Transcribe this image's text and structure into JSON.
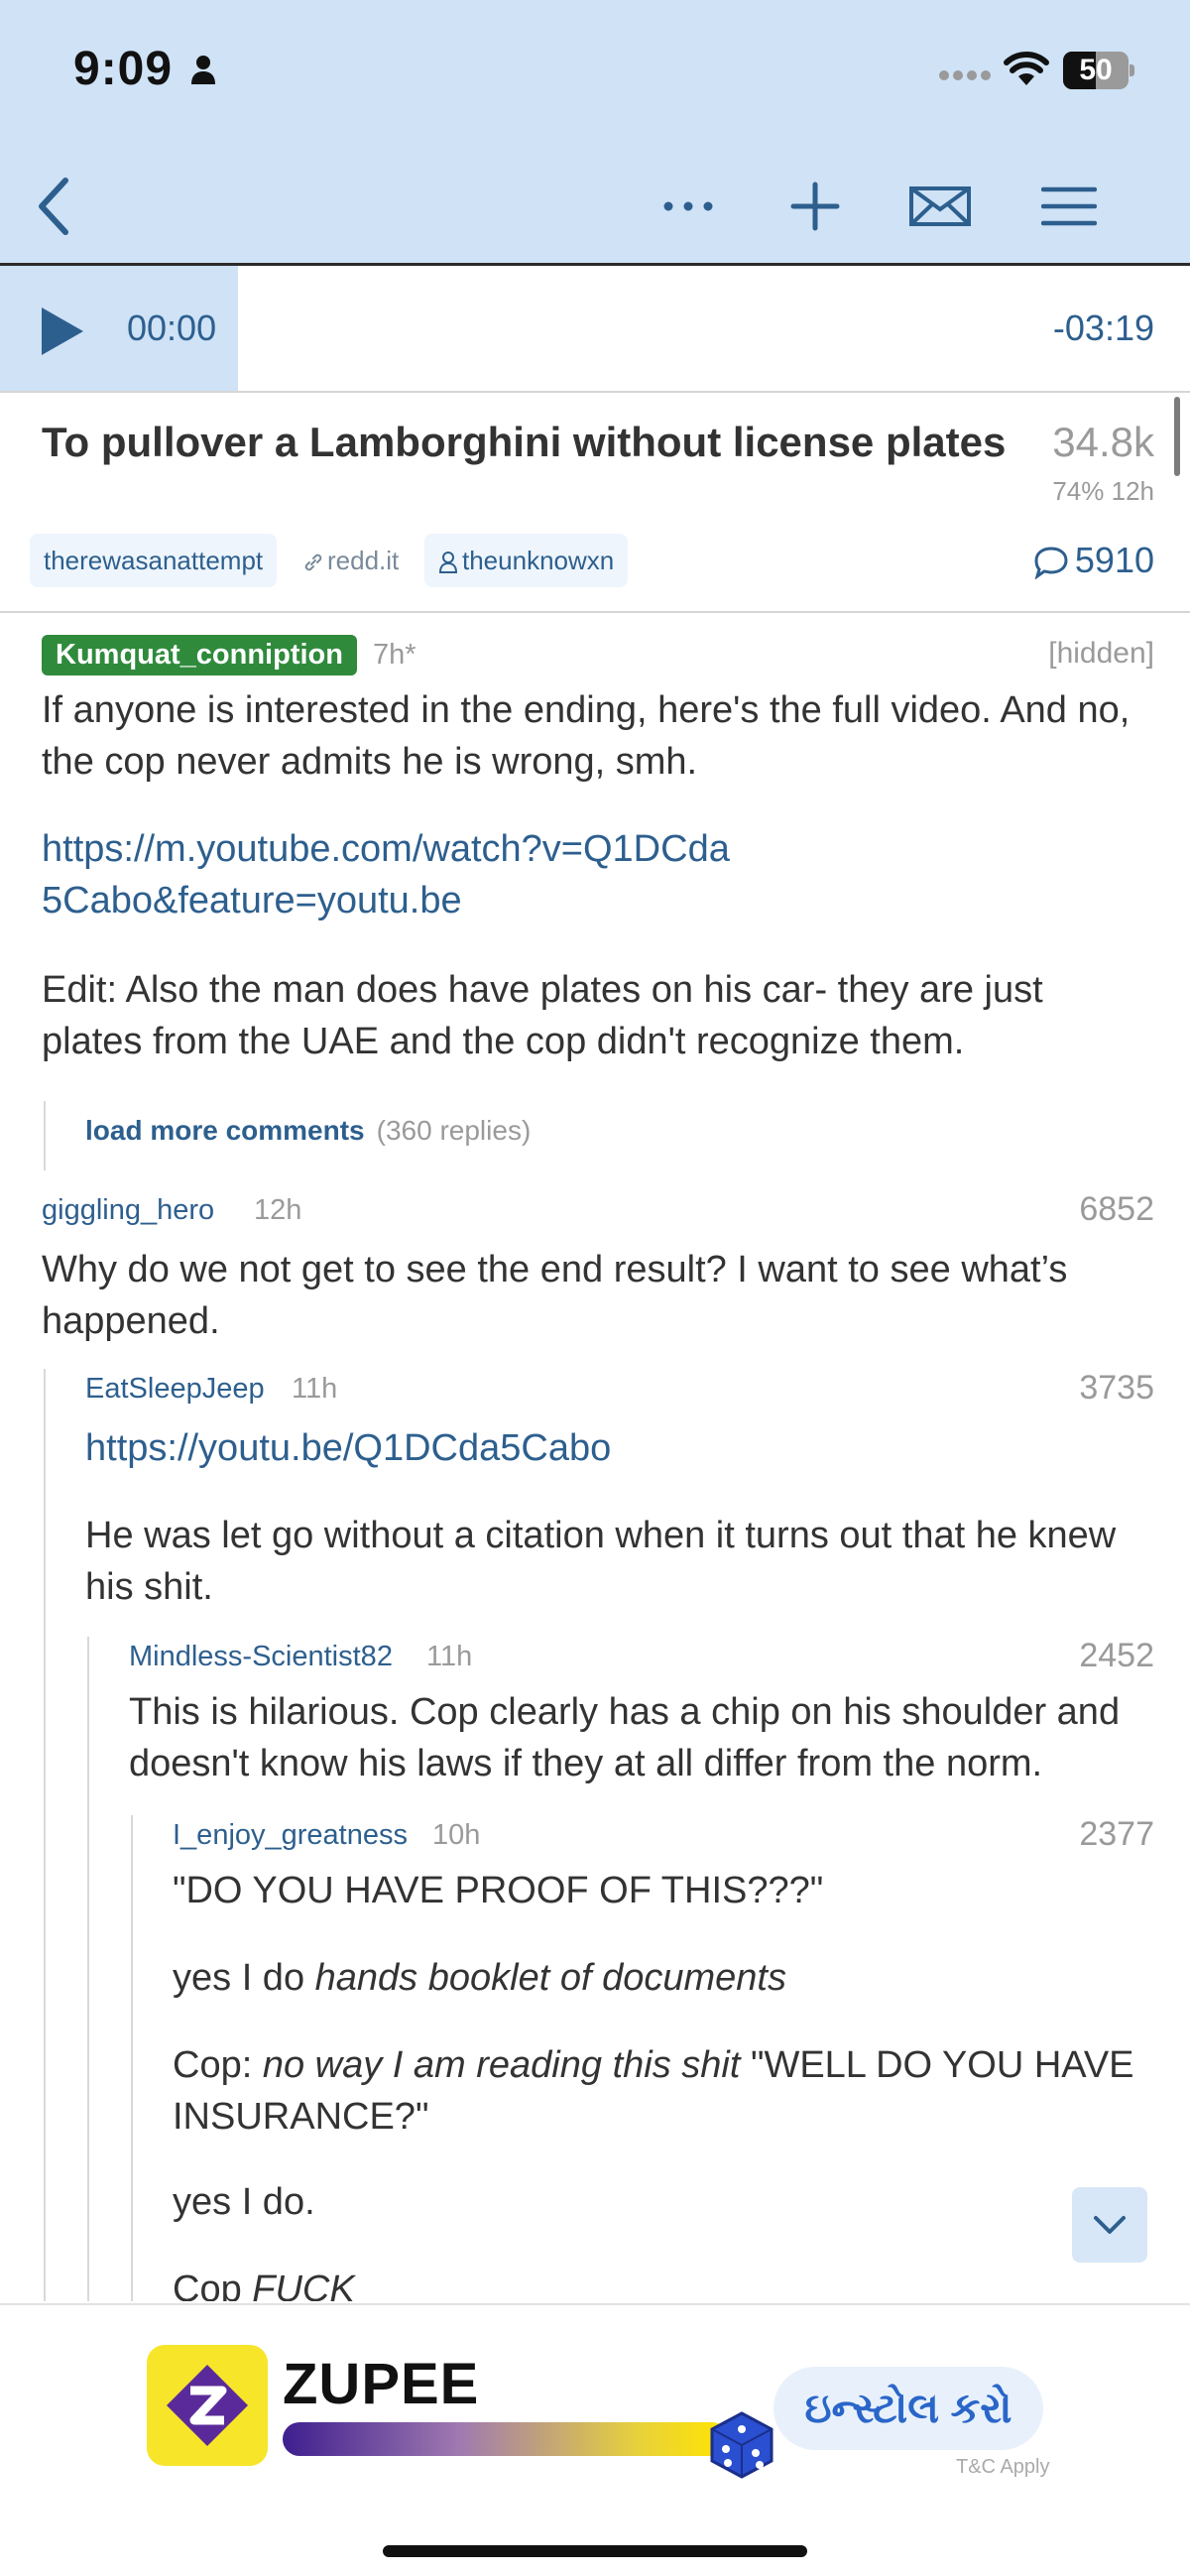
{
  "status_bar": {
    "time": "9:09",
    "battery": "50",
    "battery_level": 0.5,
    "icons": [
      "person-icon",
      "signal-dots-icon",
      "wifi-icon",
      "battery-icon"
    ]
  },
  "nav": {
    "icons": [
      "back-chevron-icon",
      "more-dots-icon",
      "plus-icon",
      "envelope-icon",
      "hamburger-menu-icon"
    ]
  },
  "player": {
    "current": "00:00",
    "remaining": "-03:19",
    "progress": 0.2
  },
  "post": {
    "title": "To pullover a Lamborghini without license plates",
    "score": "34.8k",
    "meta": "74% 12h",
    "subreddit": "therewasanattempt",
    "domain": "redd.it",
    "author": "theunknowxn",
    "comment_count": "5910"
  },
  "comments": [
    {
      "author": "Kumquat_conniption",
      "age": "7h*",
      "status": "[hidden]",
      "para1": "If anyone is interested in the ending, here's the full video. And no, the cop never admits he is wrong, smh.",
      "link": "https://m.youtube.com/watch?v=Q1DCda5Cabo&feature=youtu.be",
      "para2": "Edit: Also the man does have plates on his car- they are just plates from the UAE and the cop didn't recognize them.",
      "load_more": "load more comments",
      "load_more_count": "(360 replies)"
    },
    {
      "author": "giggling_hero",
      "age": "12h",
      "score": "6852",
      "text": "Why do we not get to see the end result? I want to see what’s happened."
    },
    {
      "author": "EatSleepJeep",
      "age": "11h",
      "score": "3735",
      "link": "https://youtu.be/Q1DCda5Cabo",
      "text": "He was let go without a citation when it turns out that he knew his shit."
    },
    {
      "author": "Mindless-Scientist82",
      "age": "11h",
      "score": "2452",
      "text": "This is hilarious.  Cop clearly has a chip on his shoulder and doesn't know his laws if they at all differ from the norm."
    },
    {
      "author": "I_enjoy_greatness",
      "age": "10h",
      "score": "2377",
      "line1": "\"DO YOU HAVE PROOF OF THIS???\"",
      "line2_plain": "yes I do ",
      "line2_em": "hands booklet of documents",
      "line3_plain": "Cop: ",
      "line3_em": "no way I am reading this shit",
      "line3_rest": " \"WELL DO YOU HAVE INSURANCE?\"",
      "line4": "yes I do.",
      "line5_plain": "Cop ",
      "line5_em": "FUCK"
    }
  ],
  "scroll_down_icon": "chevron-down-icon",
  "ad": {
    "brand": "ZUPEE",
    "cta": "ઇન્સ્ટોલ કરો",
    "terms": "T&C Apply"
  },
  "colors": {
    "header_bg": "#cfe2f6",
    "accent": "#2d5f8e",
    "badge_green": "#2f8a3c"
  }
}
